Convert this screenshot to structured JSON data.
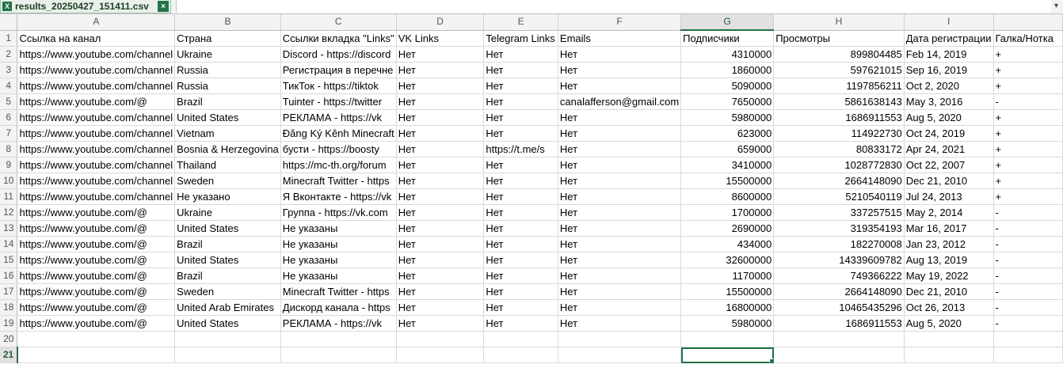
{
  "tab": {
    "file_name": "results_20250427_151411.csv",
    "excel_glyph": "X",
    "close_glyph": "×",
    "chevron": "▾"
  },
  "columns": [
    "A",
    "B",
    "C",
    "D",
    "E",
    "F",
    "G",
    "H",
    "I",
    ""
  ],
  "active": {
    "row": "21",
    "col": "G"
  },
  "rows": [
    {
      "n": "1",
      "cells": [
        "Ссылка на канал",
        "Страна",
        "Ссылки вкладка \"Links\"",
        "VK Links",
        "Telegram Links",
        "Emails",
        "Подписчики",
        "Просмотры",
        "Дата регистрации",
        "Галка/Нотка"
      ]
    },
    {
      "n": "2",
      "cells": [
        "https://www.youtube.com/channel",
        "Ukraine",
        "Discord - https://discord",
        "Нет",
        "Нет",
        "Нет",
        "4310000",
        "899804485",
        "Feb 14, 2019",
        "+"
      ]
    },
    {
      "n": "3",
      "cells": [
        "https://www.youtube.com/channel",
        "Russia",
        "Регистрация в перечне",
        "Нет",
        "Нет",
        "Нет",
        "1860000",
        "597621015",
        "Sep 16, 2019",
        "+"
      ]
    },
    {
      "n": "4",
      "cells": [
        "https://www.youtube.com/channel",
        "Russia",
        "ТикТок - https://tiktok",
        "Нет",
        "Нет",
        "Нет",
        "5090000",
        "1197856211",
        "Oct 2, 2020",
        "+"
      ]
    },
    {
      "n": "5",
      "cells": [
        "https://www.youtube.com/@",
        "Brazil",
        "Tuinter - https://twitter",
        "Нет",
        "Нет",
        "canalafferson@gmail.com",
        "7650000",
        "5861638143",
        "May 3, 2016",
        "-"
      ]
    },
    {
      "n": "6",
      "cells": [
        "https://www.youtube.com/channel",
        "United States",
        "РЕКЛАМА - https://vk",
        "Нет",
        "Нет",
        "Нет",
        "5980000",
        "1686911553",
        "Aug 5, 2020",
        "+"
      ]
    },
    {
      "n": "7",
      "cells": [
        "https://www.youtube.com/channel",
        "Vietnam",
        "Đăng Ký Kênh Minecraft",
        "Нет",
        "Нет",
        "Нет",
        "623000",
        "114922730",
        "Oct 24, 2019",
        "+"
      ]
    },
    {
      "n": "8",
      "cells": [
        "https://www.youtube.com/channel",
        "Bosnia & Herzegovina",
        "бусти - https://boosty",
        "Нет",
        "https://t.me/s",
        "Нет",
        "659000",
        "80833172",
        "Apr 24, 2021",
        "+"
      ]
    },
    {
      "n": "9",
      "cells": [
        "https://www.youtube.com/channel",
        "Thailand",
        "https://mc-th.org/forum",
        "Нет",
        "Нет",
        "Нет",
        "3410000",
        "1028772830",
        "Oct 22, 2007",
        "+"
      ]
    },
    {
      "n": "10",
      "cells": [
        "https://www.youtube.com/channel",
        "Sweden",
        "Minecraft Twitter - https",
        "Нет",
        "Нет",
        "Нет",
        "15500000",
        "2664148090",
        "Dec 21, 2010",
        "+"
      ]
    },
    {
      "n": "11",
      "cells": [
        "https://www.youtube.com/channel",
        "Не указано",
        "Я Вконтакте - https://vk",
        "Нет",
        "Нет",
        "Нет",
        "8600000",
        "5210540119",
        "Jul 24, 2013",
        "+"
      ]
    },
    {
      "n": "12",
      "cells": [
        "https://www.youtube.com/@",
        "Ukraine",
        "Группа - https://vk.com",
        "Нет",
        "Нет",
        "Нет",
        "1700000",
        "337257515",
        "May 2, 2014",
        "-"
      ]
    },
    {
      "n": "13",
      "cells": [
        "https://www.youtube.com/@",
        "United States",
        "Не указаны",
        "Нет",
        "Нет",
        "Нет",
        "2690000",
        "319354193",
        "Mar 16, 2017",
        "-"
      ]
    },
    {
      "n": "14",
      "cells": [
        "https://www.youtube.com/@",
        "Brazil",
        "Не указаны",
        "Нет",
        "Нет",
        "Нет",
        "434000",
        "182270008",
        "Jan 23, 2012",
        "-"
      ]
    },
    {
      "n": "15",
      "cells": [
        "https://www.youtube.com/@",
        "United States",
        "Не указаны",
        "Нет",
        "Нет",
        "Нет",
        "32600000",
        "14339609782",
        "Aug 13, 2019",
        "-"
      ]
    },
    {
      "n": "16",
      "cells": [
        "https://www.youtube.com/@",
        "Brazil",
        "Не указаны",
        "Нет",
        "Нет",
        "Нет",
        "1170000",
        "749366222",
        "May 19, 2022",
        "-"
      ]
    },
    {
      "n": "17",
      "cells": [
        "https://www.youtube.com/@",
        "Sweden",
        "Minecraft Twitter - https",
        "Нет",
        "Нет",
        "Нет",
        "15500000",
        "2664148090",
        "Dec 21, 2010",
        "-"
      ]
    },
    {
      "n": "18",
      "cells": [
        "https://www.youtube.com/@",
        "United Arab Emirates",
        "Дискорд канала - https",
        "Нет",
        "Нет",
        "Нет",
        "16800000",
        "10465435296",
        "Oct 26, 2013",
        "-"
      ]
    },
    {
      "n": "19",
      "cells": [
        "https://www.youtube.com/@",
        "United States",
        "РЕКЛАМА - https://vk",
        "Нет",
        "Нет",
        "Нет",
        "5980000",
        "1686911553",
        "Aug 5, 2020",
        "-"
      ]
    },
    {
      "n": "20",
      "cells": [
        "",
        "",
        "",
        "",
        "",
        "",
        "",
        "",
        "",
        ""
      ]
    },
    {
      "n": "21",
      "cells": [
        "",
        "",
        "",
        "",
        "",
        "",
        "",
        "",
        "",
        ""
      ]
    }
  ]
}
